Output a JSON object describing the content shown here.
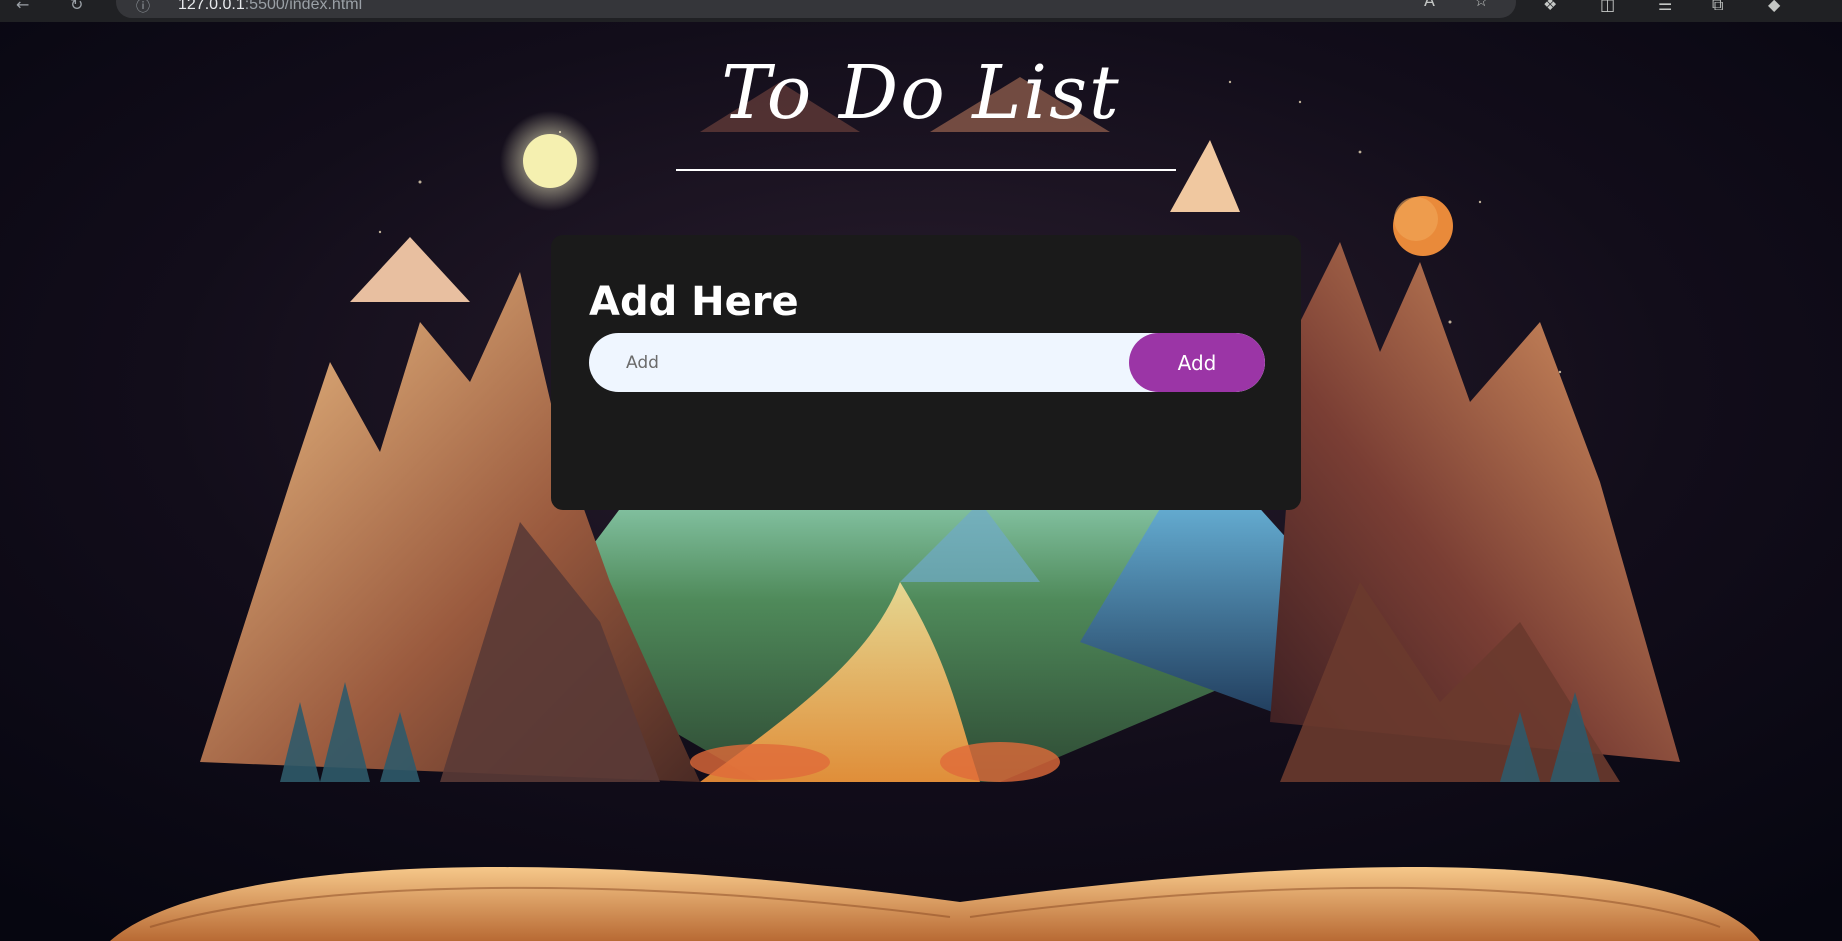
{
  "browser": {
    "url_host": "127.0.0.1",
    "url_path": ":5500/index.html"
  },
  "app": {
    "title": "To Do List",
    "card_heading": "Add Here",
    "input_placeholder": "Add",
    "input_value": "",
    "add_button_label": "Add"
  },
  "icons": {
    "back": "back-arrow-icon",
    "reload": "reload-icon",
    "site_info": "info-icon",
    "read_aloud": "read-aloud-icon",
    "favorite": "favorite-star-icon",
    "extensions": "extensions-icon",
    "split_screen": "split-screen-icon",
    "favorites_list": "favorites-list-icon",
    "collections": "collections-icon",
    "copilot": "copilot-icon"
  },
  "colors": {
    "card_background": "#1a1a1a",
    "input_background": "#eff6ff",
    "add_button": "#9b35a6",
    "title_text": "#ffffff"
  }
}
